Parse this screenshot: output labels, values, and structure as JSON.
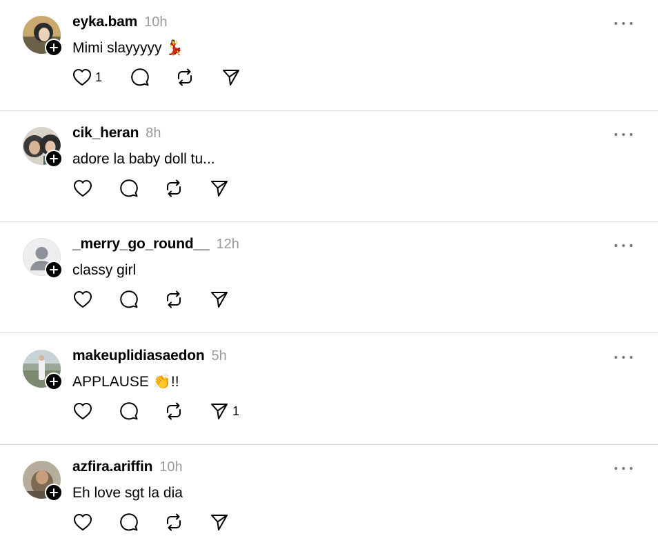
{
  "posts": [
    {
      "username": "eyka.bam",
      "time": "10h",
      "text": "Mimi slayyyyy 💃",
      "likes": "1",
      "shares": "",
      "avatar": "photo"
    },
    {
      "username": "cik_heran",
      "time": "8h",
      "text": "adore la baby doll tu...",
      "likes": "",
      "shares": "",
      "avatar": "photo"
    },
    {
      "username": "_merry_go_round__",
      "time": "12h",
      "text": "classy girl",
      "likes": "",
      "shares": "",
      "avatar": "default"
    },
    {
      "username": "makeuplidiasaedon",
      "time": "5h",
      "text": "APPLAUSE 👏!!",
      "likes": "",
      "shares": "1",
      "avatar": "photo"
    },
    {
      "username": "azfira.ariffin",
      "time": "10h",
      "text": "Eh love sgt la dia",
      "likes": "",
      "shares": "",
      "avatar": "photo"
    }
  ],
  "icons": {
    "like": "heart-icon",
    "reply": "comment-icon",
    "repost": "repost-icon",
    "share": "send-icon",
    "more": "more-icon",
    "follow": "plus-icon"
  }
}
